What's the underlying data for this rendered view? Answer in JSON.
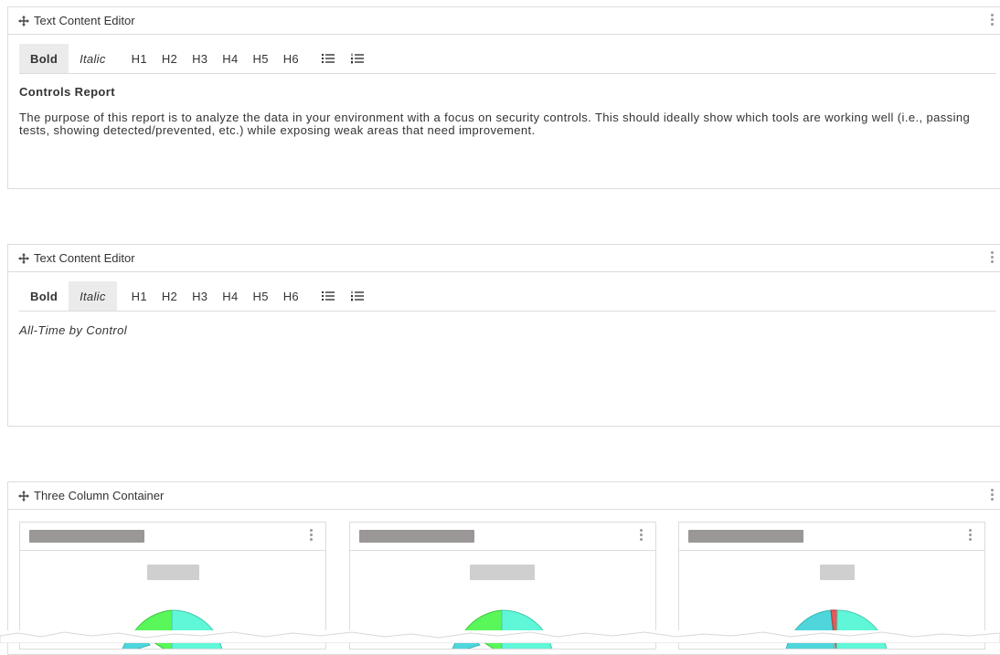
{
  "panels": [
    {
      "title": "Text Content Editor",
      "toolbar": {
        "bold": "Bold",
        "italic": "Italic",
        "headings": [
          "H1",
          "H2",
          "H3",
          "H4",
          "H5",
          "H6"
        ],
        "active": "Bold"
      },
      "heading": "Controls Report",
      "body": "The purpose of this report is to analyze the data in your environment with a focus on security controls. This should ideally show which tools are working well (i.e., passing tests, showing detected/prevented, etc.) while exposing weak areas that need improvement."
    },
    {
      "title": "Text Content Editor",
      "toolbar": {
        "bold": "Bold",
        "italic": "Italic",
        "headings": [
          "H1",
          "H2",
          "H3",
          "H4",
          "H5",
          "H6"
        ],
        "active": "Italic"
      },
      "body": "All-Time by Control"
    }
  ],
  "container": {
    "title": "Three Column Container",
    "columns": [
      {
        "gauge_colors": [
          "#4fd6dd",
          "#5af75a",
          "#5ff7d7"
        ]
      },
      {
        "gauge_colors": [
          "#4fd6dd",
          "#5af75a",
          "#5ff7d7"
        ]
      },
      {
        "gauge_colors": [
          "#4fd6dd",
          "#e65a5a",
          "#5ff7d7"
        ]
      }
    ]
  },
  "icons": {
    "move": "move-icon",
    "menu": "kebab-menu-icon",
    "bullet_list": "bulleted-list-icon",
    "numbered_list": "numbered-list-icon"
  }
}
